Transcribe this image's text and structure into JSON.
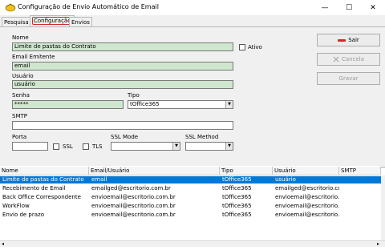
{
  "window": {
    "title": "Configuração de Envio Automático de Email",
    "minimize_glyph": "—",
    "maximize_glyph": "☐",
    "close_glyph": "✕"
  },
  "tabs": [
    {
      "label": "Pesquisa",
      "active": false
    },
    {
      "label": "Configuração",
      "active": true
    },
    {
      "label": "Envios",
      "active": false
    }
  ],
  "form": {
    "nome_label": "Nome",
    "nome_value": "Limite de pastas do Contrato",
    "ativo_label": "Ativo",
    "email_emitente_label": "Email Emitente",
    "email_emitente_value": "email",
    "usuario_label": "Usuário",
    "usuario_value": "usuário",
    "senha_label": "Senha",
    "senha_value": "*****",
    "tipo_label": "Tipo",
    "tipo_value": "tOffice365",
    "smtp_label": "SMTP",
    "smtp_value": "",
    "porta_label": "Porta",
    "porta_value": "",
    "ssl_label": "SSL",
    "tls_label": "TLS",
    "ssl_mode_label": "SSL Mode",
    "ssl_mode_value": "",
    "ssl_method_label": "SSL Method",
    "ssl_method_value": ""
  },
  "buttons": {
    "sair": "Sair",
    "cancela": "Cancela",
    "gravar": "Gravar"
  },
  "grid": {
    "columns": [
      "Nome",
      "Email/Usuário",
      "Tipo",
      "Usuário",
      "SMTP"
    ],
    "rows": [
      [
        "Limite de pastas do Contrato",
        "email",
        "tOffice365",
        "usuário",
        ""
      ],
      [
        "Recebimento de Email",
        "emailged@escritorio.com.br",
        "tOffice365",
        "emailged@escritorio.com.br",
        ""
      ],
      [
        "Back Office Correspondente",
        "envioemail@escritorio.com.br",
        "tOffice365",
        "envioemail@escritorio.com.br",
        ""
      ],
      [
        "WorkFlow",
        "envioemail@escritorio.com.br",
        "tOffice365",
        "envioemail@escritorio.com.br",
        ""
      ],
      [
        "Envio de prazo",
        "envioemail@escritorio.com.br",
        "tOffice365",
        "envioemail@escritorio.com.br",
        ""
      ]
    ],
    "selected_row": 0
  },
  "colors": {
    "accent_selection": "#0078d7",
    "field_green": "#cfe6cf",
    "tab_highlight": "#d0282a"
  }
}
